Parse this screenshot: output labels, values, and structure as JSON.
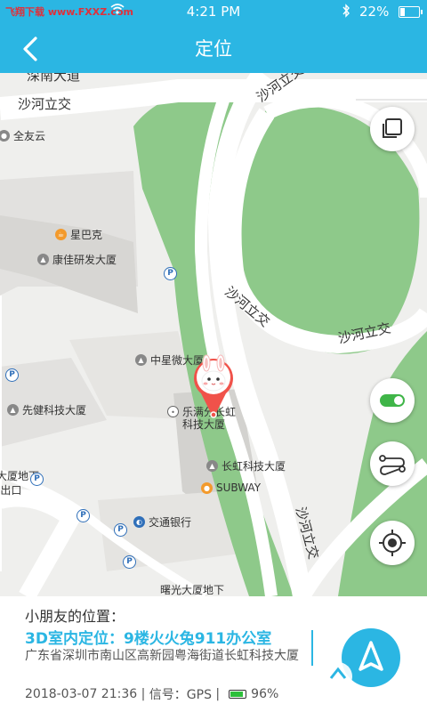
{
  "status_bar": {
    "watermark": "飞翔下载 www.FXXZ.com",
    "time": "4:21 PM",
    "battery": "22%",
    "battery_level": 0.22
  },
  "header": {
    "title": "定位"
  },
  "map": {
    "roads": {
      "top_left": "沙河立交",
      "top_diag": "沙河立交",
      "mid_diag": "沙河立交",
      "mid_right": "沙河立交",
      "lower_vert": "沙河立交",
      "top_cut": "深南大道"
    },
    "pois": {
      "jinyou": "全友云",
      "starbucks": "星巴克",
      "kangjia": "康佳研发大厦",
      "zhongxingwei": "中星微大厦",
      "xianjian": "先健科技大厦",
      "leman": "乐满分长虹",
      "leman2": "科技大厦",
      "changhong": "长虹科技大厦",
      "subway": "SUBWAY",
      "bocom": "交通银行",
      "metro": "大厦地下",
      "metro2": "-出口",
      "bottom": "曙光大厦地下"
    },
    "parking_symbol": "P",
    "controls": [
      "layers-icon",
      "toggle-switch",
      "route-icon",
      "locate-icon"
    ],
    "toggle_on": true
  },
  "panel": {
    "heading": "小朋友的位置：",
    "indoor": "3D室内定位：9楼火火兔911办公室",
    "address": "广东省深圳市南山区高新园粤海街道长虹科技大厦",
    "timestamp": "2018-03-07 21:36",
    "signal": "信号：GPS",
    "battery": "96%"
  },
  "colors": {
    "accent": "#2bb6e3",
    "green_area": "#8ec98a",
    "marker": "#f0524a"
  },
  "watermark_bottom": "飞翔下载 www.FXXZ.com"
}
